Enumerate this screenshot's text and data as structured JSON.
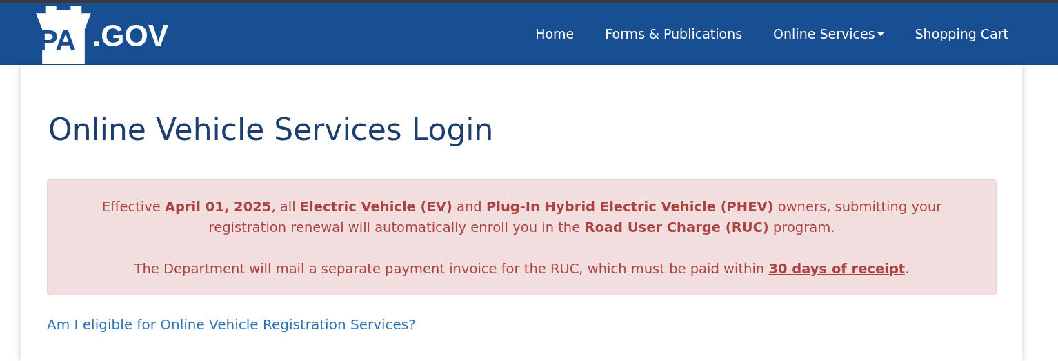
{
  "header": {
    "logo": {
      "mark": "PA",
      "suffix": ".GOV"
    },
    "nav": [
      {
        "label": "Home",
        "dropdown": false
      },
      {
        "label": "Forms & Publications",
        "dropdown": false
      },
      {
        "label": "Online Services",
        "dropdown": true
      },
      {
        "label": "Shopping Cart",
        "dropdown": false
      }
    ]
  },
  "title": "Online Vehicle Services Login",
  "notice": {
    "paragraph": "Effective **April 01, 2025**, all **Electric Vehicle (EV)** and **Plug-In Hybrid Electric Vehicle (PHEV)** owners, submitting your registration renewal will automatically enroll you in the **Road User Charge (RUC)** program.",
    "payment_before": "The Department will mail a separate payment invoice for the RUC, which must be paid within ",
    "payment_link": "30 days of receipt",
    "payment_after": "."
  },
  "eligibility_link": "Am I eligible for Online Vehicle Registration Services?"
}
